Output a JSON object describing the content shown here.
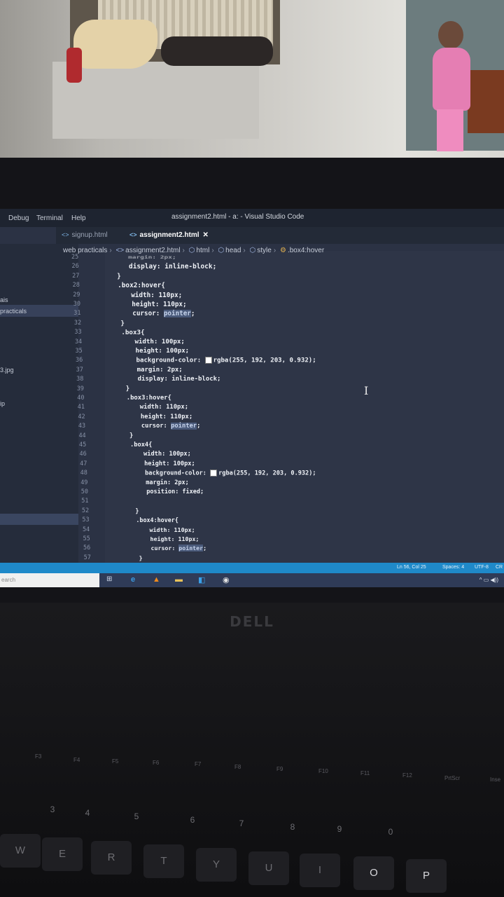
{
  "titlebar": {
    "menus": [
      "Debug",
      "Terminal",
      "Help"
    ],
    "title": "assignment2.html - a: - Visual Studio Code"
  },
  "tabs": [
    {
      "label": "signup.html",
      "active": false
    },
    {
      "label": "assignment2.html",
      "active": true
    }
  ],
  "breadcrumbs": [
    "web practicals",
    "assignment2.html",
    "html",
    "head",
    "style",
    ".box4:hover"
  ],
  "sidebar": {
    "items": [
      "ais",
      "practicals",
      "3.jpg",
      "ip"
    ]
  },
  "editor": {
    "lines": [
      {
        "n": "25",
        "text": "margin: 2px;"
      },
      {
        "n": "26",
        "text": "display: inline-block;"
      },
      {
        "n": "27",
        "text": "}"
      },
      {
        "n": "28",
        "text": ".box2:hover{"
      },
      {
        "n": "29",
        "text": "width: 110px;"
      },
      {
        "n": "30",
        "text": "height: 110px;"
      },
      {
        "n": "31",
        "text": "cursor: pointer;"
      },
      {
        "n": "32",
        "text": "}"
      },
      {
        "n": "33",
        "text": ".box3{"
      },
      {
        "n": "34",
        "text": "width: 100px;"
      },
      {
        "n": "35",
        "text": "height: 100px;"
      },
      {
        "n": "36",
        "text": "background-color: rgba(255, 192, 203, 0.932);"
      },
      {
        "n": "37",
        "text": "margin: 2px;"
      },
      {
        "n": "38",
        "text": "display: inline-block;"
      },
      {
        "n": "39",
        "text": "}"
      },
      {
        "n": "40",
        "text": ".box3:hover{"
      },
      {
        "n": "41",
        "text": "width: 110px;"
      },
      {
        "n": "42",
        "text": "height: 110px;"
      },
      {
        "n": "43",
        "text": "cursor: pointer;"
      },
      {
        "n": "44",
        "text": "}"
      },
      {
        "n": "45",
        "text": ".box4{"
      },
      {
        "n": "46",
        "text": "width: 100px;"
      },
      {
        "n": "47",
        "text": "height: 100px;"
      },
      {
        "n": "48",
        "text": "background-color: rgba(255, 192, 203, 0.932);"
      },
      {
        "n": "49",
        "text": "margin: 2px;"
      },
      {
        "n": "50",
        "text": "position: fixed;"
      },
      {
        "n": "51",
        "text": ""
      },
      {
        "n": "52",
        "text": "}"
      },
      {
        "n": "53",
        "text": ".box4:hover{"
      },
      {
        "n": "54",
        "text": "width: 110px;"
      },
      {
        "n": "55",
        "text": "height: 110px;"
      },
      {
        "n": "56",
        "text": "cursor: pointer;"
      },
      {
        "n": "57",
        "text": "}"
      }
    ]
  },
  "statusbar": {
    "position": "Ln 56, Col 25",
    "spaces": "Spaces: 4",
    "encoding": "UTF-8",
    "eol": "CR"
  },
  "taskbar": {
    "search_placeholder": "earch"
  },
  "brand": "DELL",
  "keyboard": {
    "fkeys": [
      "F3",
      "F4",
      "F5",
      "F6",
      "F7",
      "F8",
      "F9",
      "F10",
      "F11",
      "F12",
      "PrtScr",
      "Inse"
    ],
    "numrow": [
      "3",
      "4",
      "5",
      "6",
      "7",
      "8",
      "9",
      "0"
    ],
    "letters": [
      "W",
      "E",
      "R",
      "T",
      "Y",
      "U",
      "I",
      "O",
      "P"
    ]
  },
  "colors": {
    "editor_bg": "#2e3547",
    "statusbar": "#1f89c9",
    "taskbar": "#2f3b57"
  }
}
